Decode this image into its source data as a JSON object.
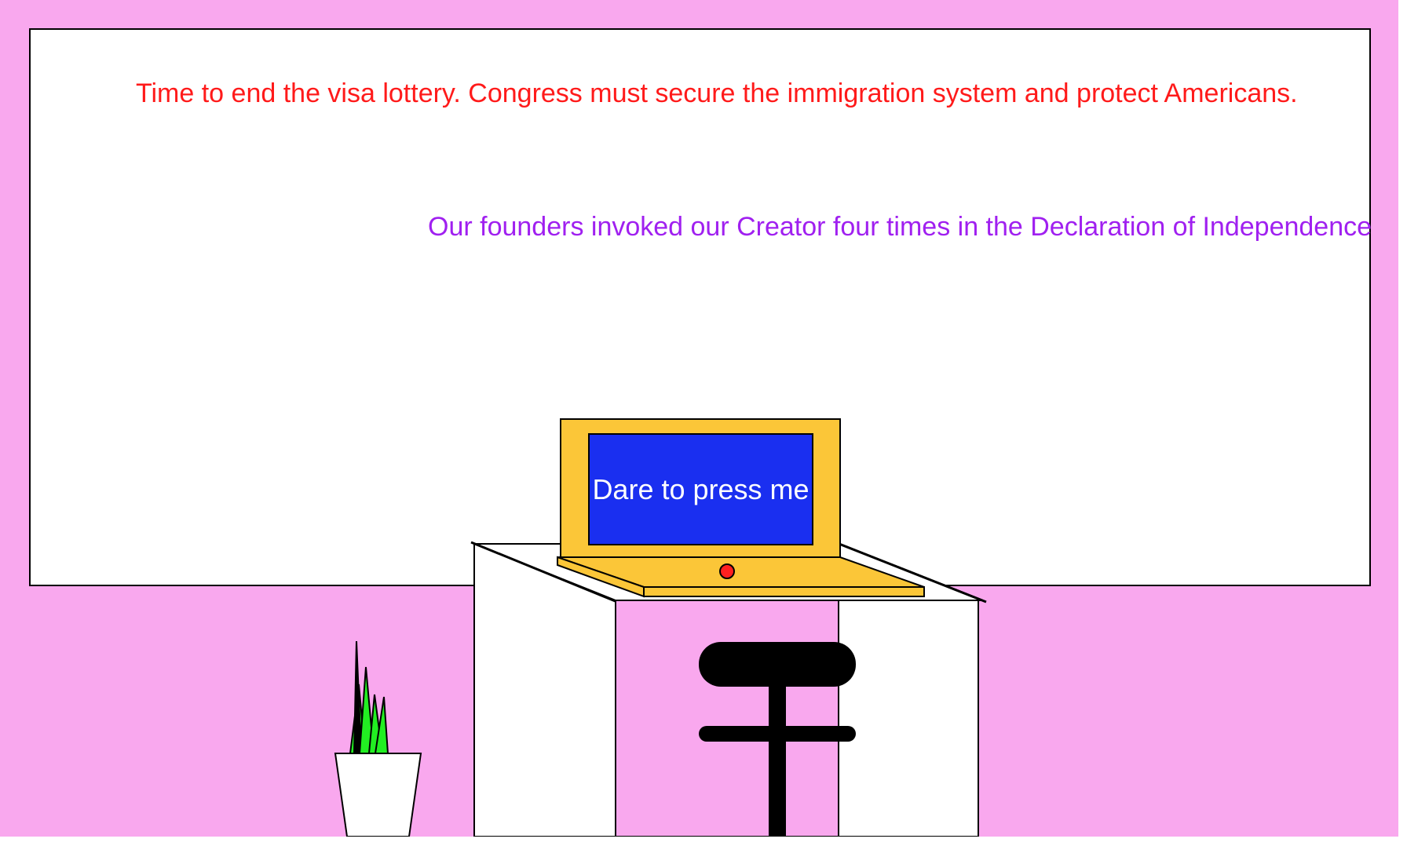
{
  "messages": {
    "red": "Time to end the visa lottery. Congress must secure the immigration system and protect Americans.",
    "purple": "Our founders invoked our Creator four times in the Declaration of Independence"
  },
  "laptop": {
    "button_label": "Dare to press me"
  },
  "colors": {
    "background": "#f9a8ee",
    "board": "#ffffff",
    "red_text": "#ff1a1a",
    "purple_text": "#a020f0",
    "laptop_body": "#fbc638",
    "laptop_screen": "#1a2ff0",
    "power_light": "#ff2020",
    "plant_leaves": "#22ee22",
    "stool": "#000000"
  },
  "icons": {
    "plant": "potted-plant-icon",
    "stool": "stool-icon",
    "power_light": "power-led-icon"
  }
}
